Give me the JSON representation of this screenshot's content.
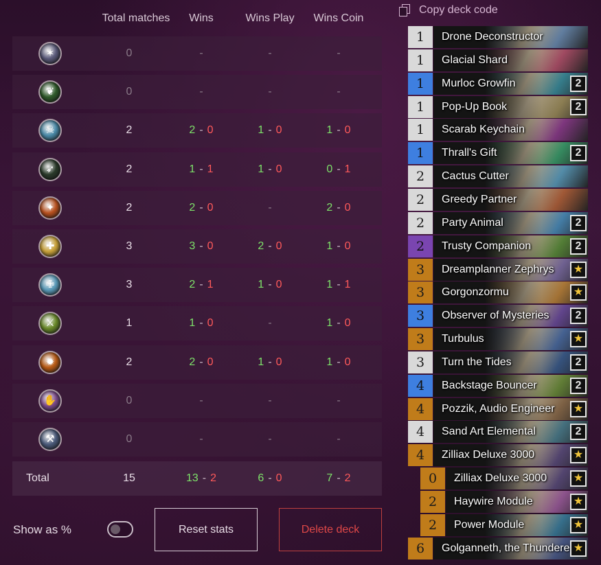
{
  "stats": {
    "headers": {
      "total": "Total matches",
      "wins": "Wins",
      "play": "Wins Play",
      "coin": "Wins Coin"
    },
    "rows": [
      {
        "class_icon": "demon-hunter-icon",
        "glyph": "✶",
        "color": "#5a5a7a",
        "total": "0",
        "wins_w": "",
        "wins_l": "",
        "play_w": "",
        "play_l": "",
        "coin_w": "",
        "coin_l": "",
        "empty": true
      },
      {
        "class_icon": "druid-icon",
        "glyph": "❦",
        "color": "#2f5a2a",
        "total": "0",
        "wins_w": "",
        "wins_l": "",
        "play_w": "",
        "play_l": "",
        "coin_w": "",
        "coin_l": "",
        "empty": true
      },
      {
        "class_icon": "death-knight-icon",
        "glyph": "☠",
        "color": "#4a8aa8",
        "total": "2",
        "wins_w": "2",
        "wins_l": "0",
        "play_w": "1",
        "play_l": "0",
        "coin_w": "1",
        "coin_l": "0"
      },
      {
        "class_icon": "hunter-icon",
        "glyph": "➶",
        "color": "#2a3a2a",
        "total": "2",
        "wins_w": "1",
        "wins_l": "1",
        "play_w": "1",
        "play_l": "0",
        "coin_w": "0",
        "coin_l": "1"
      },
      {
        "class_icon": "mage-icon",
        "glyph": "✦",
        "color": "#b8501e",
        "total": "2",
        "wins_w": "2",
        "wins_l": "0",
        "play_w": "",
        "play_l": "",
        "coin_w": "2",
        "coin_l": "0",
        "play_empty": true
      },
      {
        "class_icon": "paladin-icon",
        "glyph": "✚",
        "color": "#c9a23a",
        "total": "3",
        "wins_w": "3",
        "wins_l": "0",
        "play_w": "2",
        "play_l": "0",
        "coin_w": "1",
        "coin_l": "0"
      },
      {
        "class_icon": "priest-icon",
        "glyph": "✙",
        "color": "#5a9ab8",
        "total": "3",
        "wins_w": "2",
        "wins_l": "1",
        "play_w": "1",
        "play_l": "0",
        "coin_w": "1",
        "coin_l": "1"
      },
      {
        "class_icon": "rogue-icon",
        "glyph": "⚔",
        "color": "#6a8a2a",
        "total": "1",
        "wins_w": "1",
        "wins_l": "0",
        "play_w": "",
        "play_l": "",
        "coin_w": "1",
        "coin_l": "0",
        "play_empty": true
      },
      {
        "class_icon": "shaman-icon",
        "glyph": "✹",
        "color": "#b85a14",
        "total": "2",
        "wins_w": "2",
        "wins_l": "0",
        "play_w": "1",
        "play_l": "0",
        "coin_w": "1",
        "coin_l": "0"
      },
      {
        "class_icon": "warlock-icon",
        "glyph": "✋",
        "color": "#7a4a8a",
        "total": "0",
        "wins_w": "",
        "wins_l": "",
        "play_w": "",
        "play_l": "",
        "coin_w": "",
        "coin_l": "",
        "empty": true
      },
      {
        "class_icon": "warrior-icon",
        "glyph": "⚒",
        "color": "#4a5a7a",
        "total": "0",
        "wins_w": "",
        "wins_l": "",
        "play_w": "",
        "play_l": "",
        "coin_w": "",
        "coin_l": "",
        "empty": true
      }
    ],
    "dash": "-",
    "total_row": {
      "label": "Total",
      "total": "15",
      "wins_w": "13",
      "wins_l": "2",
      "play_w": "6",
      "play_l": "0",
      "coin_w": "7",
      "coin_l": "2"
    }
  },
  "controls": {
    "show_as_percent_label": "Show as %",
    "show_as_percent_on": false,
    "reset_label": "Reset stats",
    "delete_label": "Delete deck"
  },
  "deck": {
    "copy_label": "Copy deck code",
    "cards": [
      {
        "cost": "1",
        "name": "Drone Deconstructor",
        "rarity": "common",
        "qty": "",
        "art": "#6a8ab0"
      },
      {
        "cost": "1",
        "name": "Glacial Shard",
        "rarity": "common",
        "qty": "",
        "art": "#b0506a"
      },
      {
        "cost": "1",
        "name": "Murloc Growfin",
        "rarity": "rare",
        "qty": "2",
        "art": "#3a8a9a"
      },
      {
        "cost": "1",
        "name": "Pop-Up Book",
        "rarity": "common",
        "qty": "2",
        "art": "#9a8a5a"
      },
      {
        "cost": "1",
        "name": "Scarab Keychain",
        "rarity": "common",
        "qty": "",
        "art": "#8a3a8a"
      },
      {
        "cost": "1",
        "name": "Thrall's Gift",
        "rarity": "rare",
        "qty": "2",
        "art": "#3a9a6a"
      },
      {
        "cost": "2",
        "name": "Cactus Cutter",
        "rarity": "common",
        "qty": "",
        "art": "#5a9aba"
      },
      {
        "cost": "2",
        "name": "Greedy Partner",
        "rarity": "common",
        "qty": "",
        "art": "#b0603a"
      },
      {
        "cost": "2",
        "name": "Party Animal",
        "rarity": "common",
        "qty": "2",
        "art": "#4a8ab8"
      },
      {
        "cost": "2",
        "name": "Trusty Companion",
        "rarity": "epic",
        "qty": "2",
        "art": "#5a8a3a"
      },
      {
        "cost": "3",
        "name": "Dreamplanner Zephrys",
        "rarity": "legendary",
        "qty": "★",
        "art": "#7a6aa0"
      },
      {
        "cost": "3",
        "name": "Gorgonzormu",
        "rarity": "legendary",
        "qty": "★",
        "art": "#b8803a"
      },
      {
        "cost": "3",
        "name": "Observer of Mysteries",
        "rarity": "rare",
        "qty": "2",
        "art": "#6a4a9a"
      },
      {
        "cost": "3",
        "name": "Turbulus",
        "rarity": "legendary",
        "qty": "★",
        "art": "#4a6aa0"
      },
      {
        "cost": "3",
        "name": "Turn the Tides",
        "rarity": "common",
        "qty": "2",
        "art": "#3a5a8a"
      },
      {
        "cost": "4",
        "name": "Backstage Bouncer",
        "rarity": "rare",
        "qty": "2",
        "art": "#6a8a3a"
      },
      {
        "cost": "4",
        "name": "Pozzik, Audio Engineer",
        "rarity": "legendary",
        "qty": "★",
        "art": "#8a6a4a"
      },
      {
        "cost": "4",
        "name": "Sand Art Elemental",
        "rarity": "common",
        "qty": "2",
        "art": "#4a7a8a"
      },
      {
        "cost": "4",
        "name": "Zilliax Deluxe 3000",
        "rarity": "legendary",
        "qty": "★",
        "art": "#5a4a7a"
      },
      {
        "cost": "0",
        "name": "Zilliax Deluxe 3000",
        "rarity": "legendary",
        "qty": "★",
        "art": "#5a4a7a",
        "sub": true
      },
      {
        "cost": "2",
        "name": "Haywire Module",
        "rarity": "legendary",
        "qty": "★",
        "art": "#9a5a9a",
        "sub": true
      },
      {
        "cost": "2",
        "name": "Power Module",
        "rarity": "legendary",
        "qty": "★",
        "art": "#3a7a9a",
        "sub": true
      },
      {
        "cost": "6",
        "name": "Golganneth, the Thunderer",
        "rarity": "legendary",
        "qty": "★",
        "art": "#4a5a8a"
      }
    ]
  }
}
